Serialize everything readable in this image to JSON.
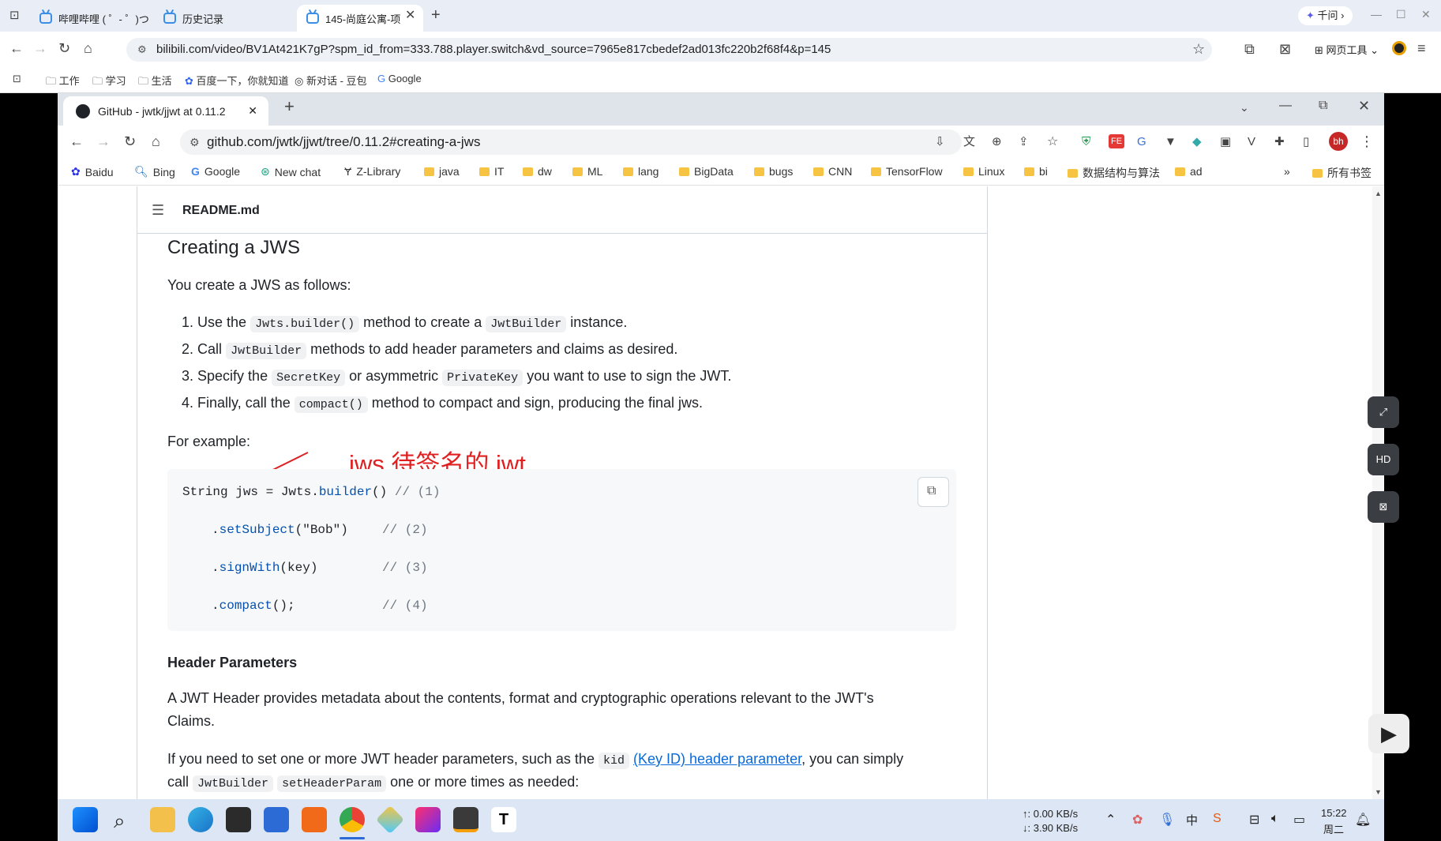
{
  "outer_browser": {
    "tabs": [
      {
        "label": "哔哩哔哩 ( ゜- ゜)つロ"
      },
      {
        "label": "历史记录"
      },
      {
        "label": "145-尚庭公寓-项"
      }
    ],
    "qianwen": "千问",
    "url": "bilibili.com/video/BV1At421K7gP?spm_id_from=333.788.player.switch&vd_source=7965e817cbedef2ad013fc220b2f68f4&p=145",
    "tools_label": "网页工具",
    "bookmarks": [
      "工作",
      "学习",
      "生活",
      "百度一下，你就知道",
      "新对话 - 豆包",
      "Google"
    ]
  },
  "inner_browser": {
    "tab_title": "GitHub - jwtk/jjwt at 0.11.2",
    "url": "github.com/jwtk/jjwt/tree/0.11.2#creating-a-jws",
    "avatar": "bh",
    "bookmarks": [
      "Baidu",
      "Bing",
      "Google",
      "New chat",
      "Z-Library",
      "java",
      "IT",
      "dw",
      "ML",
      "lang",
      "BigData",
      "bugs",
      "CNN",
      "TensorFlow",
      "Linux",
      "bi",
      "数据结构与算法",
      "ad"
    ],
    "more": "»",
    "all_bookmarks": "所有书签"
  },
  "page": {
    "readme_title": "README.md",
    "heading": "Creating a JWS",
    "intro": "You create a JWS as follows:",
    "steps": [
      {
        "n": "1.",
        "a": "Use the",
        "c1": "Jwts.builder()",
        "b": "method to create a",
        "c2": "JwtBuilder",
        "d": "instance."
      },
      {
        "n": "2.",
        "a": "Call",
        "c1": "JwtBuilder",
        "b": "methods to add header parameters and claims as desired."
      },
      {
        "n": "3.",
        "a": "Specify the",
        "c1": "SecretKey",
        "b": "or asymmetric",
        "c2": "PrivateKey",
        "d": "you want to use to sign the JWT."
      },
      {
        "n": "4.",
        "a": "Finally, call the",
        "c1": "compact()",
        "b": "method to compact and sign, producing the final jws."
      }
    ],
    "for_example": "For example:",
    "annotation": "jws 待签名的 jwt",
    "code": {
      "l1a": "String jws = Jwts.",
      "l1f": "builder",
      "l1b": "() ",
      "l1c": "// (1)",
      "l2a": ".",
      "l2f": "setSubject",
      "l2b": "(\"Bob\")",
      "l2c": "// (2)",
      "l3a": ".",
      "l3f": "signWith",
      "l3b": "(key)",
      "l3c": "// (3)",
      "l4a": ".",
      "l4f": "compact",
      "l4b": "();",
      "l4c": "// (4)"
    },
    "header_params_title": "Header Parameters",
    "header_p1_line1": "A JWT Header provides metadata about the contents, format and cryptographic operations relevant to the JWT's",
    "header_p1_line2": "Claims.",
    "header_p2_a": "If you need to set one or more JWT header parameters, such as the",
    "header_p2_code": "kid",
    "header_p2_link": "(Key ID) header parameter",
    "header_p2_b": ", you can simply",
    "header_p3_a": "call",
    "header_p3_c1": "JwtBuilder",
    "header_p3_c2": "setHeaderParam",
    "header_p3_b": "one or more times as needed:"
  },
  "taskbar": {
    "net_up": "↑: 0.00 KB/s",
    "net_down": "↓: 3.90 KB/s",
    "time": "15:22",
    "day": "周二"
  }
}
